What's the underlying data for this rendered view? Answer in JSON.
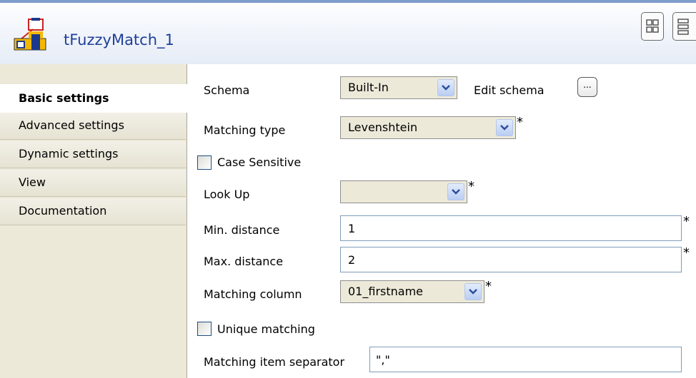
{
  "header": {
    "component_name": "tFuzzyMatch_1",
    "icon": "tfuzzymatch-component-icon"
  },
  "sidebar": {
    "tabs": [
      {
        "label": "Basic settings",
        "active": true
      },
      {
        "label": "Advanced settings",
        "active": false
      },
      {
        "label": "Dynamic settings",
        "active": false
      },
      {
        "label": "View",
        "active": false
      },
      {
        "label": "Documentation",
        "active": false
      }
    ]
  },
  "form": {
    "schema": {
      "label": "Schema",
      "value": "Built-In",
      "edit_label": "Edit schema",
      "edit_button": "..."
    },
    "matching_type": {
      "label": "Matching type",
      "value": "Levenshtein",
      "required": "*"
    },
    "case_sensitive": {
      "label": "Case Sensitive",
      "checked": false
    },
    "look_up": {
      "label": "Look Up",
      "value": "",
      "required": "*"
    },
    "min_distance": {
      "label": "Min. distance",
      "value": "1",
      "required": "*"
    },
    "max_distance": {
      "label": "Max. distance",
      "value": "2",
      "required": "*"
    },
    "matching_column": {
      "label": "Matching column",
      "value": "01_firstname",
      "required": "*"
    },
    "unique_matching": {
      "label": "Unique matching",
      "checked": false
    },
    "separator": {
      "label": "Matching item separator",
      "value": "\",\""
    }
  },
  "colors": {
    "title": "#1f3f9a",
    "sidebar_bg": "#ece9d8",
    "header_border": "#7f9dcb"
  }
}
